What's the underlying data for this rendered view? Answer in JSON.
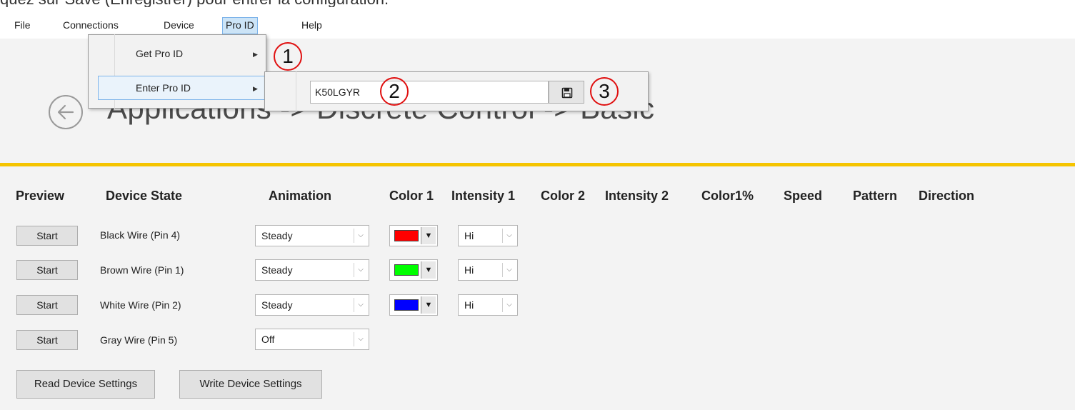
{
  "caption": "quez sur Save (Enregistrer) pour entrer la configuration.",
  "menubar": {
    "items": [
      {
        "label": "File"
      },
      {
        "label": "Connections"
      },
      {
        "label": "Device"
      },
      {
        "label": "Pro ID"
      },
      {
        "label": "Help"
      }
    ],
    "active": "Pro ID"
  },
  "dropdown": {
    "items": [
      {
        "label": "Get Pro ID"
      },
      {
        "label": "Enter Pro ID"
      }
    ]
  },
  "submenu": {
    "pro_id_value": "K50LGYR",
    "save_icon": "floppy-disk-icon"
  },
  "annotations": [
    "1",
    "2",
    "3"
  ],
  "page": {
    "title": "Applications -> Discrete Control -> Basic",
    "back_icon": "back-arrow-icon",
    "accent_color": "#f5c400"
  },
  "table": {
    "headers": [
      "Preview",
      "Device State",
      "Animation",
      "Color 1",
      "Intensity 1",
      "Color 2",
      "Intensity 2",
      "Color1%",
      "Speed",
      "Pattern",
      "Direction"
    ],
    "rows": [
      {
        "preview": "Start",
        "state": "Black Wire (Pin 4)",
        "animation": "Steady",
        "color1": "#ff0000",
        "intensity1": "Hi"
      },
      {
        "preview": "Start",
        "state": "Brown Wire (Pin 1)",
        "animation": "Steady",
        "color1": "#00ff00",
        "intensity1": "Hi"
      },
      {
        "preview": "Start",
        "state": "White Wire (Pin 2)",
        "animation": "Steady",
        "color1": "#0000ff",
        "intensity1": "Hi"
      },
      {
        "preview": "Start",
        "state": "Gray Wire (Pin 5)",
        "animation": "Off"
      }
    ]
  },
  "actions": {
    "read_label": "Read Device Settings",
    "write_label": "Write Device Settings"
  }
}
